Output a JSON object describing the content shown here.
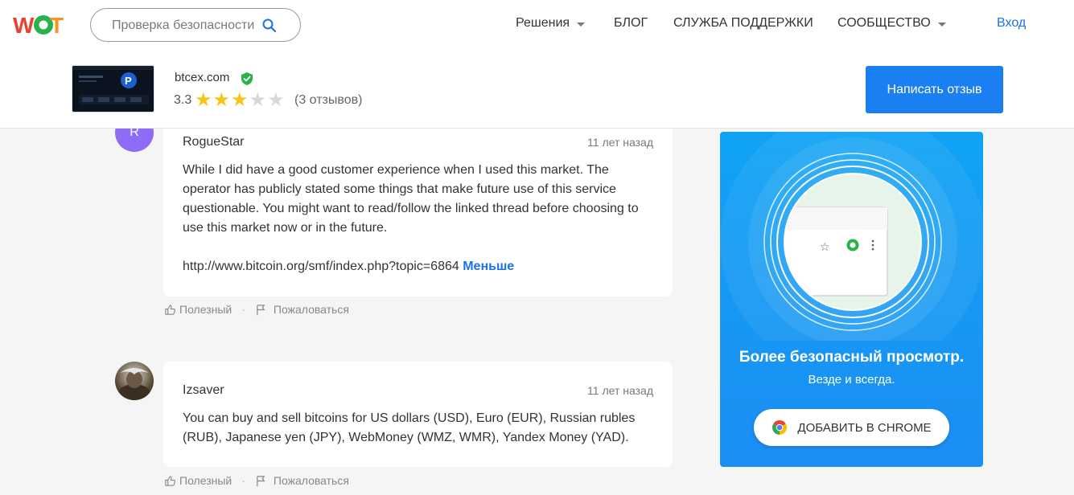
{
  "header": {
    "logo_text": "WOT",
    "search_placeholder": "Проверка безопасности",
    "nav": [
      {
        "label": "Решения",
        "has_dropdown": true
      },
      {
        "label": "БЛОГ",
        "has_dropdown": false
      },
      {
        "label": "СЛУЖБА ПОДДЕРЖКИ",
        "has_dropdown": false
      },
      {
        "label": "СООБЩЕСТВО",
        "has_dropdown": true
      }
    ],
    "login": "Вход"
  },
  "site": {
    "domain": "btcex.com",
    "verified_icon": "shield-check-icon",
    "rating": "3.3",
    "rating_value": 3.3,
    "stars_filled": 3,
    "stars_total": 5,
    "reviews_count": "(3 отзывов)",
    "write_review": "Написать отзыв"
  },
  "reviews": [
    {
      "avatar_letter": "R",
      "author": "RogueStar",
      "date": "11 лет назад",
      "text": "While I did have a good customer experience when I used this market. The operator has publicly stated some things that make future use of this service questionable. You might want to read/follow the linked thread before choosing to use this market now or in the future.",
      "link": "http://www.bitcoin.org/smf/index.php?topic=6864",
      "less": "Меньше",
      "helpful": "Полезный",
      "report": "Пожаловаться"
    },
    {
      "author": "Izsaver",
      "date": "11 лет назад",
      "text": "You can buy and sell bitcoins for US dollars (USD), Euro (EUR), Russian rubles (RUB), Japanese yen (JPY), WebMoney (WMZ, WMR), Yandex Money (YAD).",
      "helpful": "Полезный",
      "report": "Пожаловаться"
    }
  ],
  "promo": {
    "title": "Более безопасный просмотр.",
    "subtitle": "Везде и всегда.",
    "button": "ДОБАВИТЬ В CHROME",
    "bg_color": "#1b8ef4"
  },
  "colors": {
    "accent": "#1a73e8",
    "button_blue": "#1a7ff0",
    "star": "#f5c518",
    "avatar": "#8f6cf5"
  }
}
